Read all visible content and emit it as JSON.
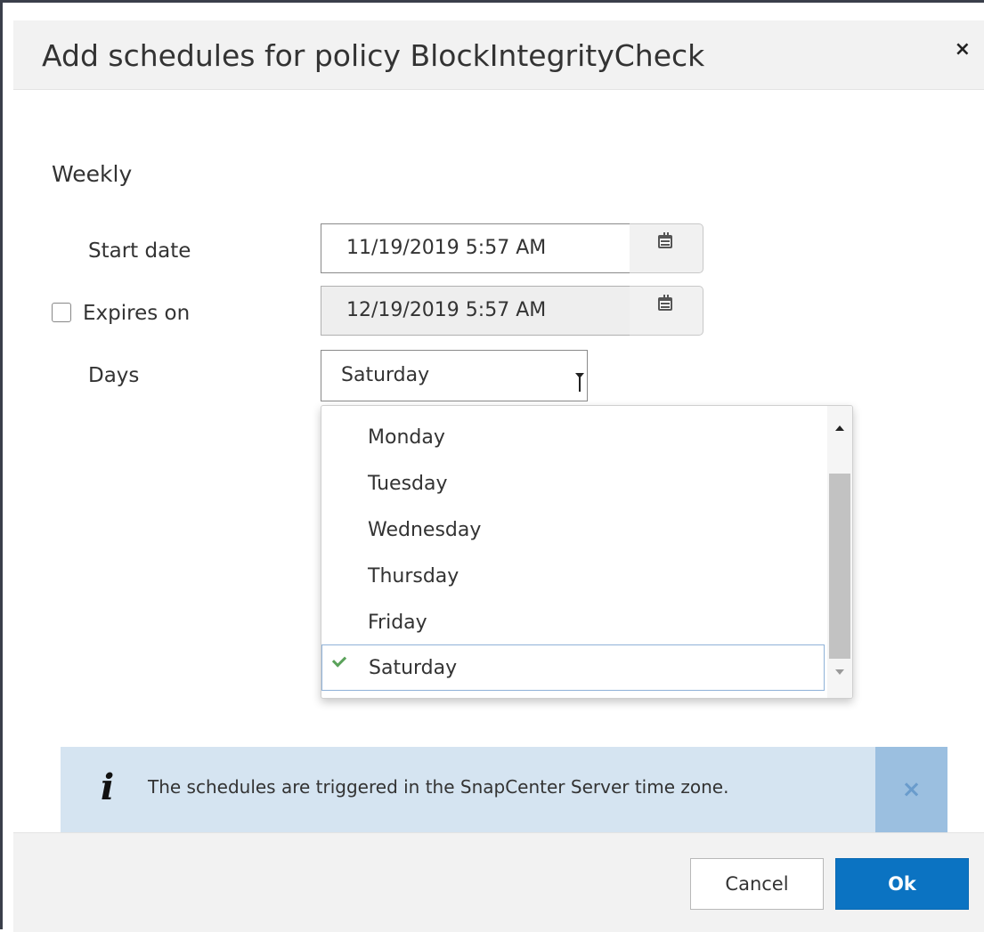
{
  "dialog": {
    "title": "Add schedules for policy BlockIntegrityCheck",
    "close_symbol": "×"
  },
  "form": {
    "section_title": "Weekly",
    "start_date": {
      "label": "Start date",
      "value": "11/19/2019 5:57 AM",
      "icon": "calendar-icon"
    },
    "expires_on": {
      "label": "Expires on",
      "checked": false,
      "value": "12/19/2019 5:57 AM",
      "icon": "calendar-icon"
    },
    "days": {
      "label": "Days",
      "selected": "Saturday",
      "options": [
        "Monday",
        "Tuesday",
        "Wednesday",
        "Thursday",
        "Friday",
        "Saturday"
      ]
    }
  },
  "info": {
    "icon": "info-icon",
    "text": "The schedules are triggered in the SnapCenter Server time zone.",
    "close_symbol": "×"
  },
  "footer": {
    "cancel_label": "Cancel",
    "ok_label": "Ok"
  },
  "colors": {
    "primary": "#0b73c2",
    "info_bg": "#d5e4f1",
    "check": "#5aa25a"
  }
}
